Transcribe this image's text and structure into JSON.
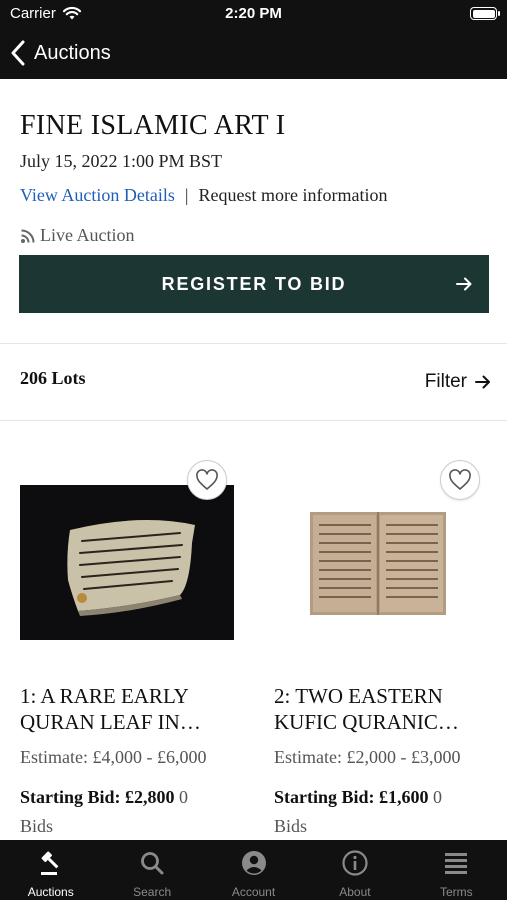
{
  "status_bar": {
    "carrier": "Carrier",
    "time": "2:20 PM"
  },
  "nav": {
    "back_label": "Auctions"
  },
  "auction": {
    "title": "FINE ISLAMIC ART I",
    "date": "July 15, 2022 1:00 PM BST",
    "view_details": "View Auction Details",
    "separator": "|",
    "request_info": "Request more information",
    "type": "Live Auction",
    "register_label": "REGISTER TO BID"
  },
  "lots_bar": {
    "count": "206 Lots",
    "filter_label": "Filter"
  },
  "lots": [
    {
      "title_line1": "1: A RARE EARLY",
      "title_line2": "QURAN LEAF IN…",
      "estimate": "Estimate: £4,000 - £6,000",
      "starting_bid_label": "Starting Bid:",
      "starting_bid_value": "£2,800",
      "bid_count": "0",
      "bids_label": "Bids"
    },
    {
      "title_line1": "2: TWO EASTERN",
      "title_line2": "KUFIC QURANIC…",
      "estimate": "Estimate: £2,000 - £3,000",
      "starting_bid_label": "Starting Bid:",
      "starting_bid_value": "£1,600",
      "bid_count": "0",
      "bids_label": "Bids"
    }
  ],
  "tabs": [
    {
      "label": "Auctions",
      "icon": "gavel-icon",
      "active": true
    },
    {
      "label": "Search",
      "icon": "search-icon",
      "active": false
    },
    {
      "label": "Account",
      "icon": "account-icon",
      "active": false
    },
    {
      "label": "About",
      "icon": "info-icon",
      "active": false
    },
    {
      "label": "Terms",
      "icon": "terms-icon",
      "active": false
    }
  ],
  "colors": {
    "header_bg": "#111111",
    "register_button": "#1c3634",
    "link": "#1f5fb8",
    "tab_active": "#ffffff",
    "tab_inactive": "#8a8a8a"
  }
}
